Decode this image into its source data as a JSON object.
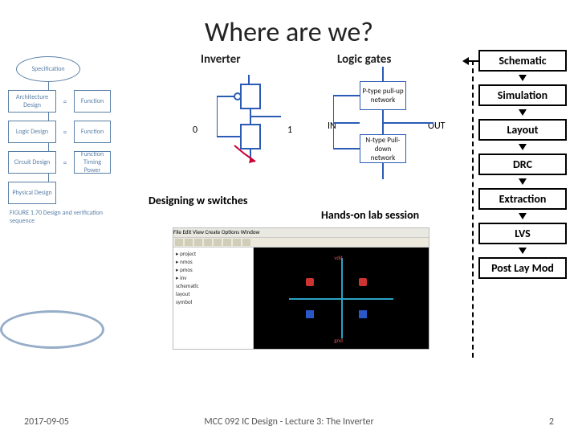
{
  "title": "Where are we?",
  "labels": {
    "inverter": "Inverter",
    "logic_gates": "Logic gates",
    "designing_switches": "Designing w switches",
    "hands_on": "Hands-on lab session"
  },
  "inverter_io": {
    "in": "0",
    "out": "1"
  },
  "logic_net": {
    "in": "IN",
    "out": "OUT",
    "pull_up": "P-type pull-up network",
    "pull_down": "N-type Pull-down network"
  },
  "left_flow": {
    "start": "Specification",
    "steps": [
      {
        "box": "Architecture Design",
        "func": "Function"
      },
      {
        "box": "Logic Design",
        "func": "Function"
      },
      {
        "box": "Circuit Design",
        "func": "Function Timing Power"
      },
      {
        "box": "Physical Design",
        "func": ""
      }
    ],
    "caption": "FIGURE 1.70 Design and verification sequence"
  },
  "right_flow": [
    "Schematic",
    "Simulation",
    "Layout",
    "DRC",
    "Extraction",
    "LVS",
    "Post Lay Mod"
  ],
  "eda": {
    "menubar": "File  Edit  View  Create  Options  Window",
    "tree": [
      "▸ project",
      "  ▸ nmos",
      "  ▸ pmos",
      "  ▸ inv",
      "    schematic",
      "    layout",
      "    symbol"
    ]
  },
  "footer": {
    "date": "2017-09-05",
    "center": "MCC 092 IC Design - Lecture 3: The Inverter",
    "page": "2"
  }
}
